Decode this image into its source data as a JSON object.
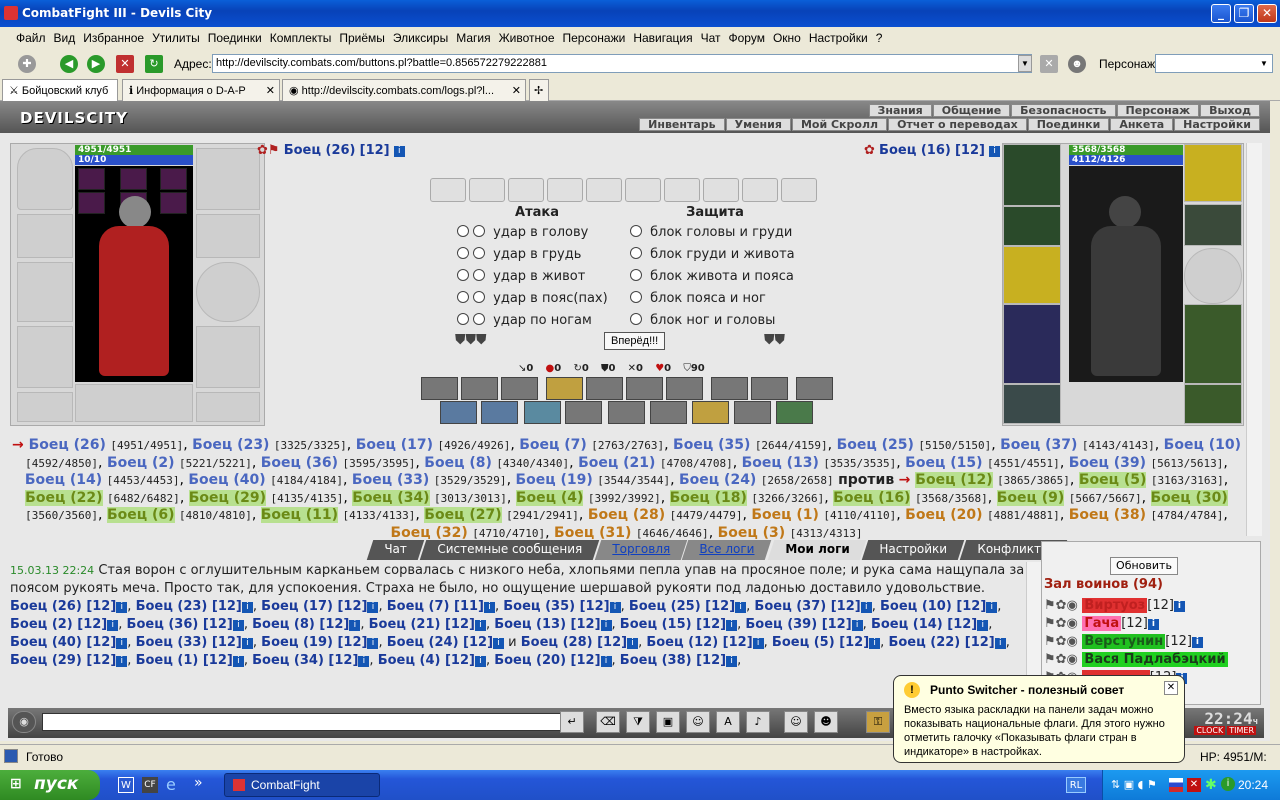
{
  "window": {
    "title": "CombatFight III - Devils City"
  },
  "menu": [
    "Файл",
    "Вид",
    "Избранное",
    "Утилиты",
    "Поединки",
    "Комплекты",
    "Приёмы",
    "Эликсиры",
    "Магия",
    "Животное",
    "Персонажи",
    "Навигация",
    "Чат",
    "Форум",
    "Окно",
    "Настройки",
    "?"
  ],
  "address": {
    "label": "Адрес:",
    "value": "http://devilscity.combats.com/buttons.pl?battle=0.856572279222881",
    "persona_label": "Персонаж:"
  },
  "tabs": [
    "Бойцовский клуб",
    "Информация о D-A-P",
    "http://devilscity.combats.com/logs.pl?l..."
  ],
  "game": {
    "logo": "DEVILSCITY",
    "nav1": [
      "Знания",
      "Общение",
      "Безопасность",
      "Персонаж",
      "Выход"
    ],
    "nav2": [
      "Инвентарь",
      "Умения",
      "Мой Скролл",
      "Отчет о переводах",
      "Поединки",
      "Анкета",
      "Настройки"
    ],
    "left": {
      "name": "Боец (26)",
      "level": "[12]",
      "hp": "4951/4951",
      "mp": "10/10"
    },
    "right": {
      "name": "Боец (16)",
      "level": "[12]",
      "hp": "3568/3568",
      "mp": "4112/4126"
    },
    "attack_title": "Атака",
    "defense_title": "Защита",
    "attacks": [
      "удар в голову",
      "удар в грудь",
      "удар в живот",
      "удар в пояс(пах)",
      "удар по ногам"
    ],
    "defenses": [
      "блок головы и груди",
      "блок груди и живота",
      "блок живота и пояса",
      "блок пояса и ног",
      "блок ног и головы"
    ],
    "forward_button": "Вперёд!!!",
    "stats": [
      "0",
      "0",
      "0",
      "0",
      "0",
      "0",
      "90"
    ]
  },
  "roster": {
    "vs": "против",
    "blue": [
      [
        "Боец (26)",
        "[4951/4951]"
      ],
      [
        "Боец (23)",
        "[3325/3325]"
      ],
      [
        "Боец (17)",
        "[4926/4926]"
      ],
      [
        "Боец (7)",
        "[2763/2763]"
      ],
      [
        "Боец (35)",
        "[2644/4159]"
      ],
      [
        "Боец (25)",
        "[5150/5150]"
      ],
      [
        "Боец (37)",
        "[4143/4143]"
      ],
      [
        "Боец (10)",
        "[4592/4850]"
      ],
      [
        "Боец (2)",
        "[5221/5221]"
      ],
      [
        "Боец (36)",
        "[3595/3595]"
      ],
      [
        "Боец (8)",
        "[4340/4340]"
      ],
      [
        "Боец (21)",
        "[4708/4708]"
      ],
      [
        "Боец (13)",
        "[3535/3535]"
      ],
      [
        "Боец (15)",
        "[4551/4551]"
      ],
      [
        "Боец (39)",
        "[5613/5613]"
      ],
      [
        "Боец (14)",
        "[4453/4453]"
      ],
      [
        "Боец (40)",
        "[4184/4184]"
      ],
      [
        "Боец (33)",
        "[3529/3529]"
      ],
      [
        "Боец (19)",
        "[3544/3544]"
      ],
      [
        "Боец (24)",
        "[2658/2658]"
      ]
    ],
    "green": [
      [
        "Боец (12)",
        "[3865/3865]"
      ],
      [
        "Боец (5)",
        "[3163/3163]"
      ],
      [
        "Боец (22)",
        "[6482/6482]"
      ],
      [
        "Боец (29)",
        "[4135/4135]"
      ],
      [
        "Боец (34)",
        "[3013/3013]"
      ],
      [
        "Боец (4)",
        "[3992/3992]"
      ],
      [
        "Боец (18)",
        "[3266/3266]"
      ],
      [
        "Боец (16)",
        "[3568/3568]"
      ],
      [
        "Боец (9)",
        "[5667/5667]"
      ],
      [
        "Боец (30)",
        "[3560/3560]"
      ],
      [
        "Боец (6)",
        "[4810/4810]"
      ],
      [
        "Боец (11)",
        "[4133/4133]"
      ],
      [
        "Боец (27)",
        "[2941/2941]"
      ]
    ],
    "orange": [
      [
        "Боец (28)",
        "[4479/4479]"
      ],
      [
        "Боец (1)",
        "[4110/4110]"
      ],
      [
        "Боец (20)",
        "[4881/4881]"
      ],
      [
        "Боец (38)",
        "[4784/4784]"
      ],
      [
        "Боец (32)",
        "[4710/4710]"
      ],
      [
        "Боец (31)",
        "[4646/4646]"
      ],
      [
        "Боец (3)",
        "[4313/4313]"
      ]
    ]
  },
  "chat": {
    "tabs": [
      "Чат",
      "Системные сообщения",
      "Торговля",
      "Все логи",
      "Мои логи",
      "Настройки",
      "Конфликты"
    ],
    "time": "15.03.13 22:24",
    "text": "Стая ворон с оглушительным карканьем сорвалась с низкого неба, хлопьями пепла упав на просяное поле; и рука сама нащупала за поясом рукоять меча. Просто так, для успокоения. Страха не было, но ощущение шершавой рукояти под ладонью доставило удовольствие.",
    "names": [
      "Боец (26) [12]",
      "Боец (23) [12]",
      "Боец (17) [12]",
      "Боец (7) [11]",
      "Боец (35) [12]",
      "Боец (25) [12]",
      "Боец (37) [12]",
      "Боец (10) [12]",
      "Боец (2) [12]",
      "Боец (36) [12]",
      "Боец (8) [12]",
      "Боец (21) [12]",
      "Боец (13) [12]",
      "Боец (15) [12]",
      "Боец (39) [12]",
      "Боец (14) [12]",
      "Боец (40) [12]",
      "Боец (33) [12]",
      "Боец (19) [12]",
      "Боец (24) [12]",
      "Боец (28) [12]",
      "Боец (12) [12]",
      "Боец (5) [12]",
      "Боец (22) [12]",
      "Боец (29) [12]",
      "Боец (1) [12]",
      "Боец (34) [12]",
      "Боец (4) [12]",
      "Боец (20) [12]",
      "Боец (38) [12]"
    ],
    "and": "и"
  },
  "hall": {
    "refresh": "Обновить",
    "title": "Зал воинов (94)",
    "warriors": [
      {
        "name": "Виртуоз",
        "level": "[12]",
        "bg": "#e03030",
        "color": "#c02020"
      },
      {
        "name": "Гача",
        "level": "[12]",
        "bg": "#ff70b0",
        "color": "#c01010"
      },
      {
        "name": "Верстунин",
        "level": "[12]",
        "bg": "#20c020",
        "color": "#1a5a1a"
      },
      {
        "name": "Вася Падлабэцкий",
        "level": "",
        "bg": "#20d020",
        "color": "#1a3a1a"
      },
      {
        "name": "",
        "level": "[12]",
        "bg": "#e03030",
        "color": "#c02020"
      }
    ]
  },
  "clock": {
    "time": "22:24",
    "suffix": "ч",
    "labels": [
      "CLOCK",
      "TIMER"
    ]
  },
  "statusbar": {
    "text": "Готово",
    "hp": "HP: 4951/M:"
  },
  "taskbar": {
    "start": "пуск",
    "task": "CombatFight",
    "lang": "RL",
    "time": "20:24"
  },
  "balloon": {
    "title": "Punto Switcher - полезный совет",
    "body": "Вместо языка раскладки на панели задач можно показывать национальные флаги. Для этого нужно отметить галочку «Показывать флаги стран в индикаторе» в настройках."
  }
}
